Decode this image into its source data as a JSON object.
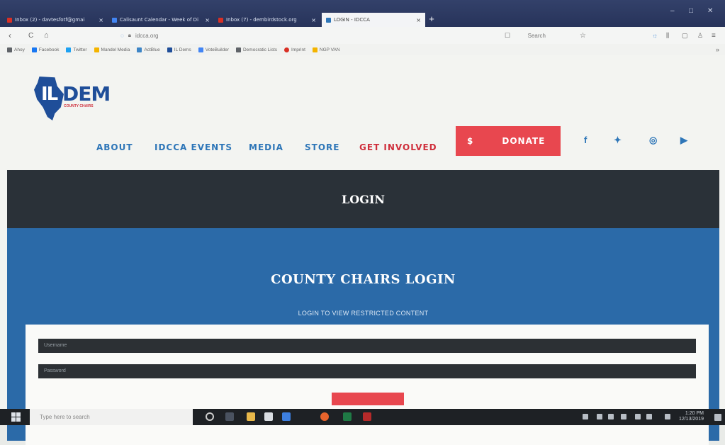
{
  "browser": {
    "tabs": [
      {
        "label": "Inbox (2) - davtesfotf@gmai",
        "color": "#d93025"
      },
      {
        "label": "Calisaunt Calendar - Week of Di",
        "color": "#4285f4"
      },
      {
        "label": "Inbox (7) - dembirdstock.org",
        "color": "#d93025"
      },
      {
        "label": "LOGIN - IDCCA",
        "color": "#2e76b8"
      }
    ],
    "new_tab": "+",
    "window_controls": [
      "–",
      "□",
      "✕"
    ],
    "nav_back": "‹",
    "nav_reload": "C",
    "nav_home": "⌂",
    "url": "idcca.org",
    "url_right": "Search",
    "bookmarks": [
      {
        "label": "Ahoy",
        "color": "#5f6368"
      },
      {
        "label": "Facebook",
        "color": "#1877f2"
      },
      {
        "label": "Twitter",
        "color": "#1da1f2"
      },
      {
        "label": "Mandel Media",
        "color": "#f4b400"
      },
      {
        "label": "ActBlue",
        "color": "#3d85c6"
      },
      {
        "label": "IL Dems",
        "color": "#1f4e99"
      },
      {
        "label": "VoteBuilder",
        "color": "#4285f4"
      },
      {
        "label": "Democratic Lists",
        "color": "#5f6368"
      },
      {
        "label": "Imprint",
        "color": "#d93025"
      },
      {
        "label": "NGP VAN",
        "color": "#f4b400"
      }
    ],
    "bookmarks_more": "»"
  },
  "site": {
    "logo": {
      "il": "IL",
      "dem": "DEM",
      "tag": "COUNTY CHAIRS"
    },
    "nav": {
      "about": "ABOUT",
      "events": "IDCCA EVENTS",
      "media": "MEDIA",
      "store": "STORE",
      "get_involved": "GET INVOLVED"
    },
    "donate": {
      "symbol": "$",
      "label": "DONATE"
    },
    "social": {
      "facebook": "f",
      "twitter": "✦",
      "instagram": "◎",
      "youtube": "▶"
    },
    "banner_title": "LOGIN",
    "login": {
      "title": "COUNTY CHAIRS LOGIN",
      "subtitle": "LOGIN TO VIEW RESTRICTED CONTENT",
      "username_placeholder": "Username",
      "password_placeholder": "Password"
    }
  },
  "taskbar": {
    "search_placeholder": "Type here to search",
    "time": "1:20 PM",
    "date": "12/13/2019"
  },
  "colors": {
    "accent_blue": "#2e76b8",
    "accent_red": "#e8474f",
    "dark_band": "#2a3138",
    "panel_blue": "#2b6aa8"
  }
}
